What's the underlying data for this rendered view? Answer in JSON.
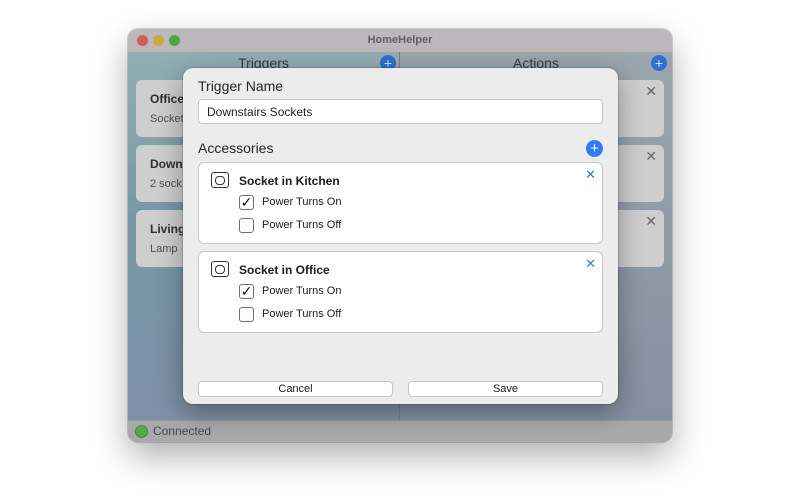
{
  "window": {
    "title": "HomeHelper",
    "traffic_lights": [
      "#f3645c",
      "#f7bd3c",
      "#48c541"
    ]
  },
  "triggers_panel": {
    "header": "Triggers",
    "add_icon": "plus-circle-icon",
    "items": [
      {
        "title": "Office",
        "subtitle": "Socket"
      },
      {
        "title": "Downs",
        "subtitle": "2 sock"
      },
      {
        "title": "Living",
        "subtitle": "Lamp"
      }
    ]
  },
  "actions_panel": {
    "header": "Actions",
    "add_icon": "plus-circle-icon",
    "close_glyph": "✕"
  },
  "status": {
    "text": "Connected",
    "color": "#5cc150"
  },
  "sheet": {
    "name_label": "Trigger Name",
    "name_value": "Downstairs Sockets",
    "accessories_label": "Accessories",
    "add_glyph": "+",
    "accessories": [
      {
        "name": "Socket in Kitchen",
        "icon": "power-socket-icon",
        "close_glyph": "✕",
        "options": [
          {
            "label": "Power Turns On",
            "checked": true,
            "mark": "✓"
          },
          {
            "label": "Power Turns Off",
            "checked": false,
            "mark": ""
          }
        ]
      },
      {
        "name": "Socket in Office",
        "icon": "power-socket-icon",
        "close_glyph": "✕",
        "options": [
          {
            "label": "Power Turns On",
            "checked": true,
            "mark": "✓"
          },
          {
            "label": "Power Turns Off",
            "checked": false,
            "mark": ""
          }
        ]
      }
    ],
    "cancel_label": "Cancel",
    "save_label": "Save"
  },
  "accent_color": "#2f7cf6"
}
